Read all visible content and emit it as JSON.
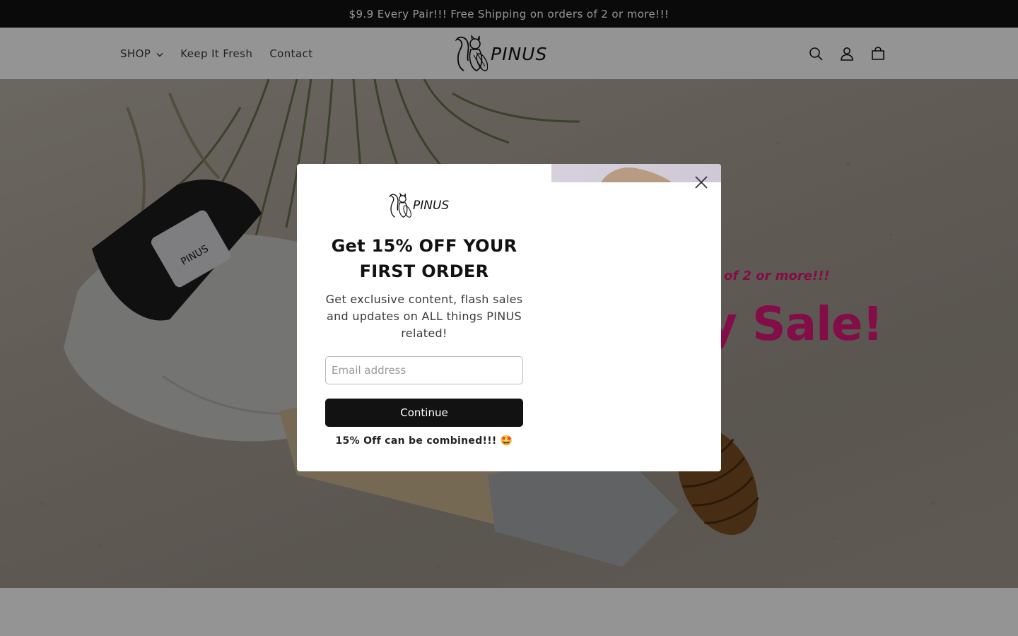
{
  "announcement": {
    "text": "$9.9 Every Pair!!! Free Shipping on orders of 2 or more!!!"
  },
  "header": {
    "nav": [
      {
        "label": "SHOP",
        "has_dropdown": true
      },
      {
        "label": "Keep It Fresh"
      },
      {
        "label": "Contact"
      }
    ],
    "logo_text": "PINUS",
    "icons": [
      "search-icon",
      "account-icon",
      "cart-icon"
    ]
  },
  "hero": {
    "subheading": "of 2 or more!!!",
    "heading": "y Sale!"
  },
  "popup": {
    "logo_text": "PINUS",
    "title": "Get 15% OFF YOUR FIRST ORDER",
    "description": "Get exclusive content, flash sales and updates on ALL things PINUS related!",
    "email_placeholder": "Email address",
    "button_label": "Continue",
    "note": "15% Off can be combined!!! 🤩",
    "close_icon": "close-icon"
  },
  "colors": {
    "accent": "#e0187c",
    "announcement_bg": "#121212",
    "button_bg": "#121212"
  }
}
